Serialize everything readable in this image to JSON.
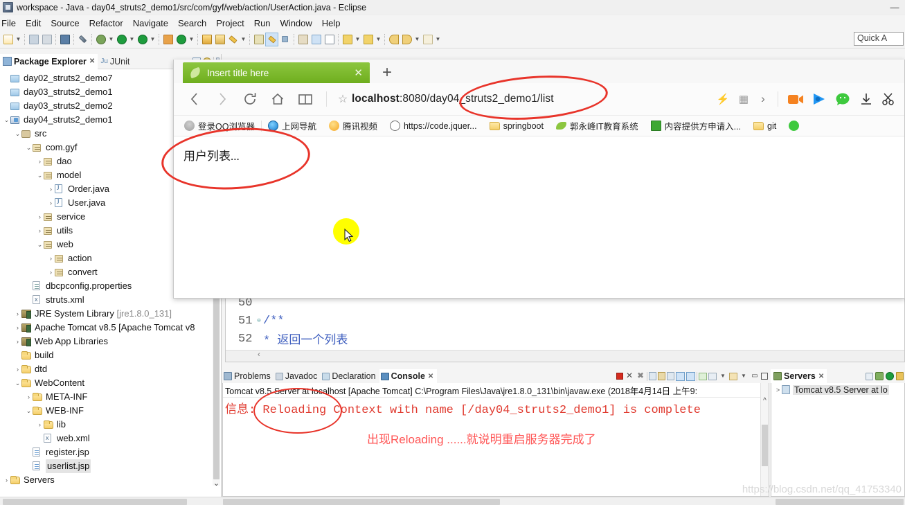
{
  "eclipse": {
    "title": "workspace - Java - day04_struts2_demo1/src/com/gyf/web/action/UserAction.java - Eclipse",
    "window_controls": [
      "—",
      "▭",
      "✕"
    ],
    "menu": [
      "File",
      "Edit",
      "Source",
      "Refactor",
      "Navigate",
      "Search",
      "Project",
      "Run",
      "Window",
      "Help"
    ],
    "quick_access": "Quick A",
    "explorer": {
      "tab_label": "Package Explorer",
      "tab_close": "✕",
      "second_tab_label": "JUnit",
      "second_tab_prefix": "Ju",
      "tree": [
        {
          "label": "day02_struts2_demo7",
          "indent": 0,
          "twist": "",
          "icon": "project-closed"
        },
        {
          "label": "day03_struts2_demo1",
          "indent": 0,
          "twist": "",
          "icon": "project-closed"
        },
        {
          "label": "day03_struts2_demo2",
          "indent": 0,
          "twist": "",
          "icon": "project-closed"
        },
        {
          "label": "day04_struts2_demo1",
          "indent": 0,
          "twist": "v",
          "icon": "project-open"
        },
        {
          "label": "src",
          "indent": 1,
          "twist": "v",
          "icon": "source-folder"
        },
        {
          "label": "com.gyf",
          "indent": 2,
          "twist": "v",
          "icon": "package"
        },
        {
          "label": "dao",
          "indent": 3,
          "twist": ">",
          "icon": "package"
        },
        {
          "label": "model",
          "indent": 3,
          "twist": "v",
          "icon": "package"
        },
        {
          "label": "Order.java",
          "indent": 4,
          "twist": ">",
          "icon": "java-file"
        },
        {
          "label": "User.java",
          "indent": 4,
          "twist": ">",
          "icon": "java-file"
        },
        {
          "label": "service",
          "indent": 3,
          "twist": ">",
          "icon": "package"
        },
        {
          "label": "utils",
          "indent": 3,
          "twist": ">",
          "icon": "package"
        },
        {
          "label": "web",
          "indent": 3,
          "twist": "v",
          "icon": "package"
        },
        {
          "label": "action",
          "indent": 4,
          "twist": ">",
          "icon": "package"
        },
        {
          "label": "convert",
          "indent": 4,
          "twist": ">",
          "icon": "package"
        },
        {
          "label": "dbcpconfig.properties",
          "indent": 2,
          "twist": "",
          "icon": "file"
        },
        {
          "label": "struts.xml",
          "indent": 2,
          "twist": "",
          "icon": "xml-file"
        },
        {
          "label": "JRE System Library [jre1.8.0_131]",
          "indent": 1,
          "twist": ">",
          "icon": "library"
        },
        {
          "label": "Apache Tomcat v8.5 [Apache Tomcat v8",
          "indent": 1,
          "twist": ">",
          "icon": "library"
        },
        {
          "label": "Web App Libraries",
          "indent": 1,
          "twist": ">",
          "icon": "library"
        },
        {
          "label": "build",
          "indent": 1,
          "twist": "",
          "icon": "folder"
        },
        {
          "label": "dtd",
          "indent": 1,
          "twist": ">",
          "icon": "folder"
        },
        {
          "label": "WebContent",
          "indent": 1,
          "twist": "v",
          "icon": "folder"
        },
        {
          "label": "META-INF",
          "indent": 2,
          "twist": ">",
          "icon": "folder"
        },
        {
          "label": "WEB-INF",
          "indent": 2,
          "twist": "v",
          "icon": "folder"
        },
        {
          "label": "lib",
          "indent": 3,
          "twist": ">",
          "icon": "folder"
        },
        {
          "label": "web.xml",
          "indent": 3,
          "twist": "",
          "icon": "xml-file"
        },
        {
          "label": "register.jsp",
          "indent": 2,
          "twist": "",
          "icon": "jsp-file"
        },
        {
          "label": "userlist.jsp",
          "indent": 2,
          "twist": "",
          "icon": "jsp-file",
          "selected": true
        },
        {
          "label": "Servers",
          "indent": 0,
          "twist": ">",
          "icon": "folder"
        }
      ],
      "scroll_down_glyph": "⌄"
    },
    "editor": {
      "lines": [
        {
          "num": "50",
          "fold": "",
          "text": ""
        },
        {
          "num": "51",
          "fold": "⊖",
          "text": "    /**"
        },
        {
          "num": "52",
          "fold": "",
          "text": "     * 返回一个列表"
        }
      ],
      "hscroll_glyph": "‹"
    },
    "console": {
      "tabs": [
        {
          "label": "Problems",
          "active": false,
          "icon": "problems-icon"
        },
        {
          "label": "Javadoc",
          "active": false,
          "icon": "javadoc-icon"
        },
        {
          "label": "Declaration",
          "active": false,
          "icon": "declaration-icon"
        },
        {
          "label": "Console",
          "active": true,
          "icon": "console-icon",
          "close": "✕"
        }
      ],
      "header": "Tomcat v8.5 Server at localhost [Apache Tomcat] C:\\Program Files\\Java\\jre1.8.0_131\\bin\\javaw.exe (2018年4月14日 上午9:",
      "log_line": "信息: Reloading Context with name [/day04_struts2_demo1] is complete",
      "scroll_up_glyph": "^"
    },
    "servers": {
      "tab_label": "Servers",
      "tab_close": "✕",
      "rows": [
        {
          "twist": ">",
          "label": "Tomcat v8.5 Server at lo"
        }
      ]
    }
  },
  "browser": {
    "tab": {
      "title": "Insert title here",
      "close": "✕",
      "favicon": "leaf-icon"
    },
    "new_tab": "+",
    "nav": {
      "back": "back-icon",
      "forward": "forward-icon",
      "reload": "reload-icon",
      "home": "home-icon",
      "reader": "reader-icon",
      "star": "☆"
    },
    "url": {
      "host": "localhost",
      "rest": ":8080/day04_struts2_demo1/list"
    },
    "right_icons": [
      {
        "name": "lightning-icon",
        "glyph": "⚡"
      },
      {
        "name": "qrcode-icon",
        "glyph": "▦"
      },
      {
        "name": "chevron-right-icon",
        "glyph": "›"
      },
      {
        "name": "video-record-icon",
        "glyph": ""
      },
      {
        "name": "video-play-icon",
        "glyph": ""
      },
      {
        "name": "wechat-icon",
        "glyph": ""
      },
      {
        "name": "download-icon",
        "glyph": ""
      },
      {
        "name": "scissors-icon",
        "glyph": ""
      }
    ],
    "bookmarks": [
      {
        "label": "登录QQ浏览器",
        "icon": "qq-avatar-icon"
      },
      {
        "label": "上网导航",
        "icon": "ie-globe-icon"
      },
      {
        "label": "腾讯视频",
        "icon": "tencent-video-icon"
      },
      {
        "label": "https://code.jquer...",
        "icon": "globe-icon"
      },
      {
        "label": "springboot",
        "icon": "folder-icon"
      },
      {
        "label": "郭永峰IT教育系统",
        "icon": "leaf-icon"
      },
      {
        "label": "内容提供方申请入...",
        "icon": "green-book-icon"
      },
      {
        "label": "git",
        "icon": "folder-icon"
      },
      {
        "label": "",
        "icon": "wechat-icon"
      }
    ],
    "page_body": "用户列表..."
  },
  "annotations": {
    "note_text": "出现Reloading ......就说明重启服务器完成了",
    "red_color": "#e8342a",
    "note_color": "#ff5555",
    "ellipses": [
      {
        "name": "url-highlight-ellipse"
      },
      {
        "name": "page-body-highlight-ellipse"
      },
      {
        "name": "reloading-highlight-ellipse"
      }
    ]
  },
  "watermark": "https://blog.csdn.net/qq_41753340"
}
